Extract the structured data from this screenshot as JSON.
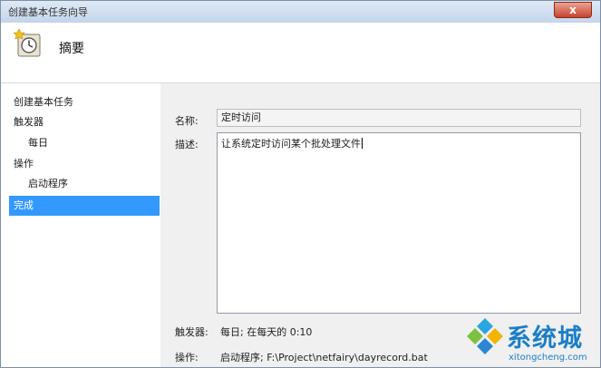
{
  "window": {
    "title": "创建基本任务向导",
    "close_glyph": "x"
  },
  "header": {
    "title": "摘要",
    "icon": "clock-task-icon"
  },
  "steps": [
    {
      "label": "创建基本任务"
    },
    {
      "label": "触发器"
    },
    {
      "label": "每日"
    },
    {
      "label": "操作"
    },
    {
      "label": "启动程序"
    },
    {
      "label": "完成"
    }
  ],
  "form": {
    "name_label": "名称:",
    "name_value": "定时访问",
    "desc_label": "描述:",
    "desc_value": "让系统定时访问某个批处理文件"
  },
  "summary": {
    "trigger_label": "触发器:",
    "trigger_value": "每日; 在每天的 0:10",
    "action_label": "操作:",
    "action_value": "启动程序; F:\\Project\\netfairy\\dayrecord.bat"
  },
  "watermark": {
    "brand": "系统城",
    "domain": "xitongcheng.com"
  },
  "colors": {
    "selection": "#3399ff",
    "watermark": "#1a7fc6"
  }
}
